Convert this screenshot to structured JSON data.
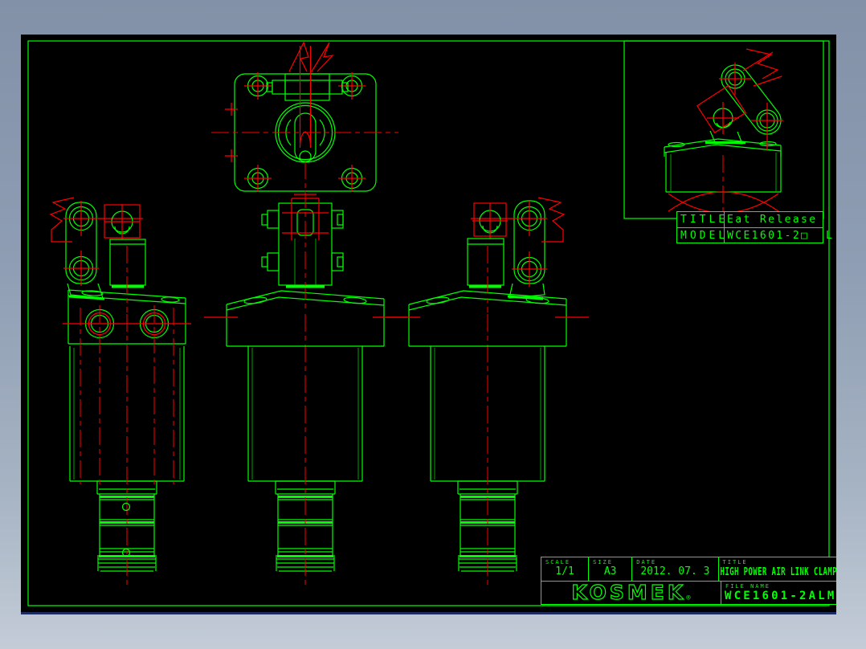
{
  "app": {
    "background_top": "#8391a8",
    "background_bottom": "#c3ccd7",
    "canvas_color": "#000000",
    "line_green": "#00ff00",
    "line_red": "#ff0000"
  },
  "detail_block": {
    "title_label": "TITLE",
    "title_value": "Eat Release",
    "model_label": "MODEL",
    "model_value": "WCE1601-2□",
    "model_suffix": "L"
  },
  "title_block": {
    "scale_label": "SCALE",
    "scale_value": "1/1",
    "size_label": "SIZE",
    "size_value": "A3",
    "date_label": "DATE",
    "date_value": "2012. 07. 3",
    "title_label": "TITLE",
    "title_value": "HIGH POWER AIR LINK CLAMP",
    "logo": "KOSMEK",
    "logo_mark": "®",
    "file_label": "FILE NAME",
    "file_value": "WCE1601-2ALM"
  }
}
